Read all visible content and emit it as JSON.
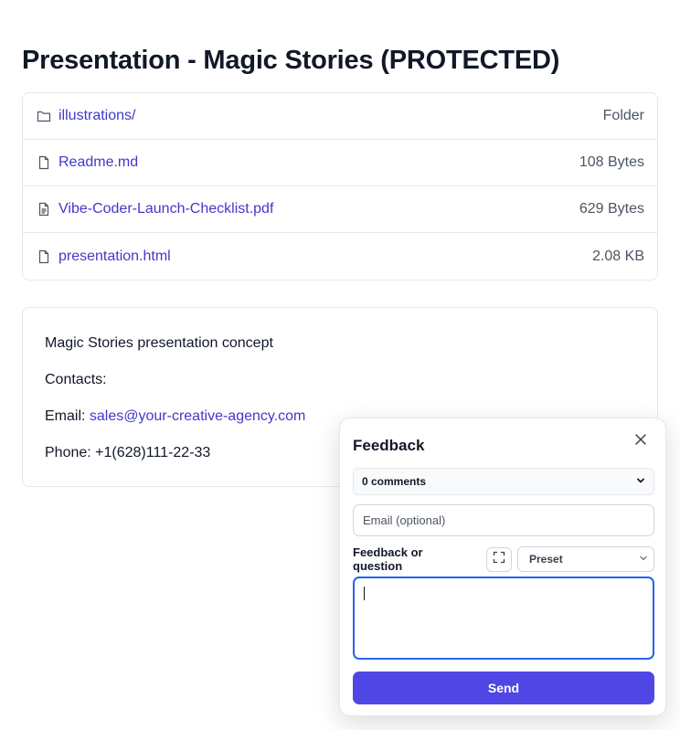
{
  "page": {
    "title": "Presentation - Magic Stories (PROTECTED)"
  },
  "files": [
    {
      "name": "illustrations/",
      "meta": "Folder",
      "icon": "folder-icon"
    },
    {
      "name": "Readme.md",
      "meta": "108 Bytes",
      "icon": "file-icon"
    },
    {
      "name": "Vibe-Coder-Launch-Checklist.pdf",
      "meta": "629 Bytes",
      "icon": "file-text-icon"
    },
    {
      "name": "presentation.html",
      "meta": "2.08 KB",
      "icon": "file-icon"
    }
  ],
  "readme": {
    "line1": "Magic Stories presentation concept",
    "contacts_label": "Contacts:",
    "email_label": "Email:",
    "email_value": "sales@your-creative-agency.com",
    "phone_text": "Phone: +1(628)111-22-33"
  },
  "feedback": {
    "title": "Feedback",
    "comments_label": "0 comments",
    "email_placeholder": "Email (optional)",
    "question_label": "Feedback or question",
    "preset_label": "Preset",
    "send_label": "Send"
  },
  "colors": {
    "link": "#4338ca",
    "accent": "#4f46e5",
    "focus": "#2563eb",
    "border": "#e5e7eb"
  }
}
